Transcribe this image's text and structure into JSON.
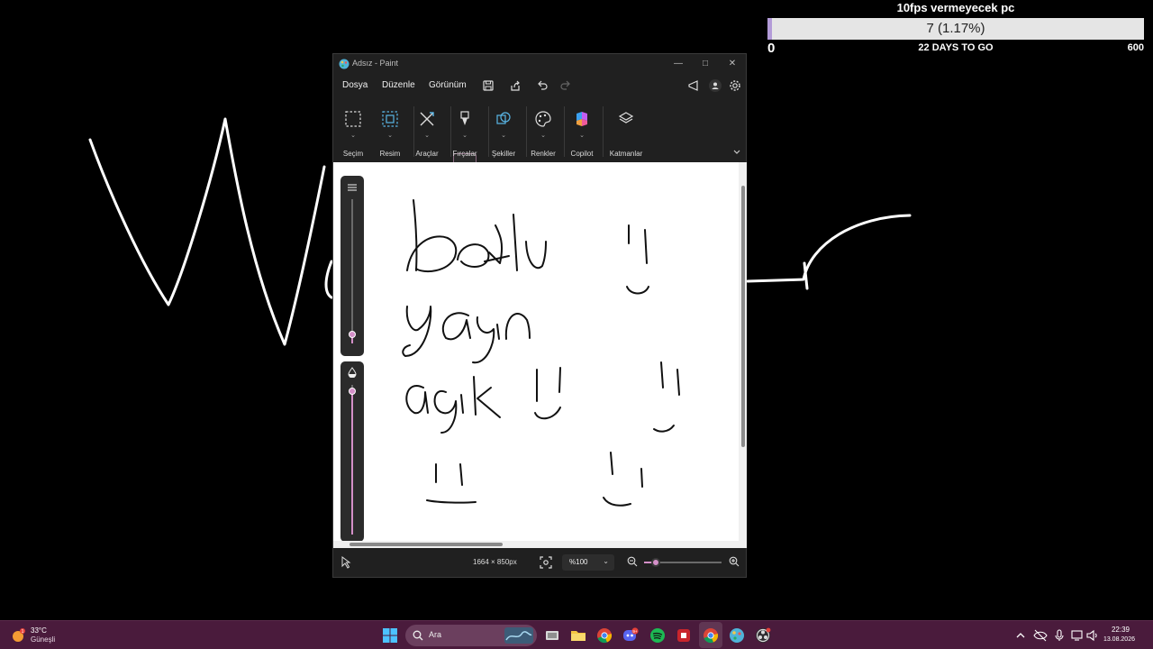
{
  "goal": {
    "title": "10fps vermeyecek pc",
    "count": "7 (1.17%)",
    "progress_percent": 1.17,
    "min": "0",
    "remaining": "22 DAYS TO GO",
    "max": "600"
  },
  "window": {
    "title": "Adsız - Paint"
  },
  "menu": {
    "file": "Dosya",
    "edit": "Düzenle",
    "view": "Görünüm"
  },
  "ribbon": {
    "selection": "Seçim",
    "image": "Resim",
    "tools": "Araçlar",
    "brushes": "Fırçalar",
    "shapes": "Şekiller",
    "colors": "Renkler",
    "copilot": "Copilot",
    "layers": "Katmanlar"
  },
  "canvas": {
    "size_percent": 6,
    "opacity_percent": 96
  },
  "status": {
    "dimensions": "1664 × 850px",
    "zoom": "%100",
    "zoom_level_fraction": 0.15
  },
  "taskbar": {
    "temperature": "33°C",
    "weather": "Güneşli",
    "weather_badge": "1",
    "search_placeholder": "Ara",
    "discord_badge": "9+",
    "time": "22:39",
    "date": "13.08.2026"
  },
  "colors": {
    "accent": "#d48fc8",
    "taskbar": "#4a1b3c",
    "window_bg": "#202020"
  }
}
